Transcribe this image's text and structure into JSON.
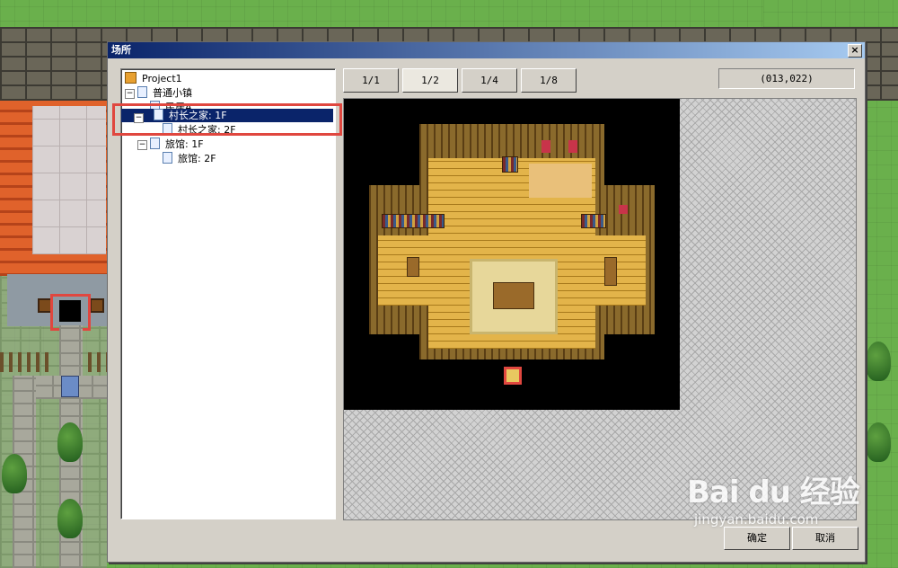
{
  "dialog": {
    "title": "场所",
    "close_label": "×",
    "ok_label": "确定",
    "cancel_label": "取消"
  },
  "tree": {
    "items": [
      {
        "label": "Project1",
        "expander": ""
      },
      {
        "label": "普通小镇",
        "expander": "−"
      },
      {
        "label": "民居A",
        "expander": ""
      },
      {
        "label": "村长之家: 1F",
        "expander": "−",
        "selected": true
      },
      {
        "label": "村长之家: 2F",
        "expander": ""
      },
      {
        "label": "旅馆: 1F",
        "expander": "−"
      },
      {
        "label": "旅馆: 2F",
        "expander": ""
      }
    ]
  },
  "scale_buttons": [
    "1/1",
    "1/2",
    "1/4",
    "1/8"
  ],
  "active_scale": "1/2",
  "coordinates": "(013,022)",
  "watermark": {
    "logo": "Bai du 经验",
    "url": "jingyan.baidu.com"
  },
  "colors": {
    "selection": "#0a246a",
    "highlight_box": "#e0473f",
    "dialog_bg": "#d4d0c8"
  }
}
